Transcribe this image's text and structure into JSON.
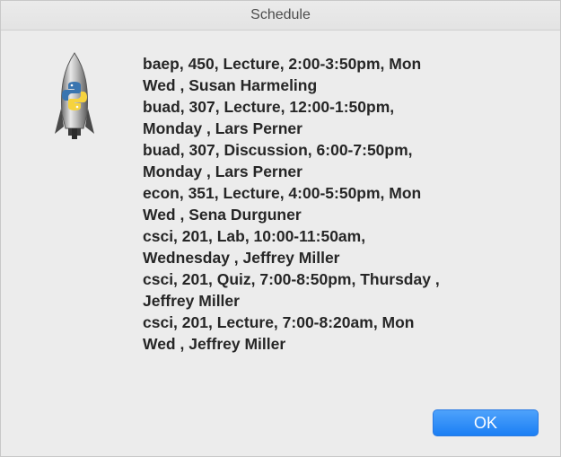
{
  "window": {
    "title": "Schedule"
  },
  "dialog": {
    "icon": "python-launcher-rocket-icon",
    "lines": [
      "baep, 450, Lecture, 2:00-3:50pm, Mon",
      "Wed , Susan Harmeling",
      "buad, 307, Lecture, 12:00-1:50pm,",
      "Monday , Lars Perner",
      "buad, 307, Discussion, 6:00-7:50pm,",
      "Monday , Lars Perner",
      "econ, 351, Lecture, 4:00-5:50pm, Mon",
      "Wed , Sena Durguner",
      "csci, 201, Lab, 10:00-11:50am,",
      "Wednesday , Jeffrey Miller",
      "csci, 201, Quiz, 7:00-8:50pm, Thursday ,",
      "Jeffrey Miller",
      "csci, 201, Lecture, 7:00-8:20am, Mon",
      "Wed , Jeffrey Miller"
    ],
    "ok_label": "OK"
  },
  "colors": {
    "background": "#ececec",
    "button": "#1b7ff4",
    "text": "#262626"
  }
}
